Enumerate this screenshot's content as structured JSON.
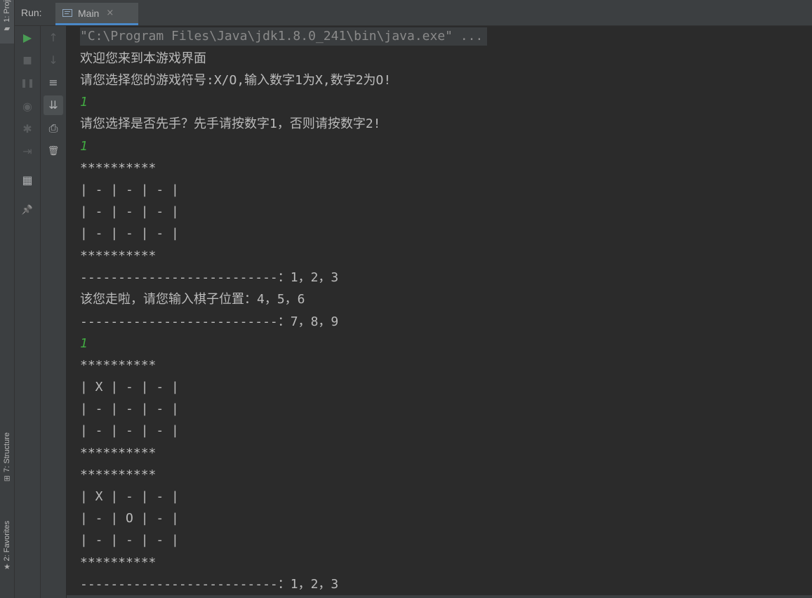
{
  "side_tabs": {
    "project": "1: Proj",
    "structure": "7: Structure",
    "favorites": "2: Favorites"
  },
  "header": {
    "run_label": "Run:",
    "tab_main": "Main",
    "tab_close": "×"
  },
  "toolbar_left": {
    "rerun": "▶",
    "stop": "■",
    "pause": "❚❚",
    "dump_threads": "◉",
    "settings": "✱",
    "exit": "⇥",
    "layout": "▦",
    "pin": "📌"
  },
  "toolbar_right": {
    "up": "↑",
    "down": "↓",
    "soft_wrap": "≡",
    "scroll_to_end": "⇊",
    "print": "⎙",
    "clear": "🗑"
  },
  "console": {
    "lines": [
      "\"C:\\Program Files\\Java\\jdk1.8.0_241\\bin\\java.exe\" ...",
      "欢迎您来到本游戏界面",
      "请您选择您的游戏符号:X/O,输入数字1为X,数字2为O!",
      "1",
      "请您选择是否先手？先手请按数字1，否则请按数字2!",
      "1",
      "**********",
      "| - | - | - |",
      "| - | - | - |",
      "| - | - | - |",
      "**********",
      "--------------------------：1，2，3",
      "该您走啦，请您输入棋子位置：4，5，6",
      "--------------------------：7，8，9",
      "1",
      "**********",
      "| X | - | - |",
      "| - | - | - |",
      "| - | - | - |",
      "**********",
      "**********",
      "| X | - | - |",
      "| - | O | - |",
      "| - | - | - |",
      "**********",
      "--------------------------：1，2，3"
    ]
  }
}
